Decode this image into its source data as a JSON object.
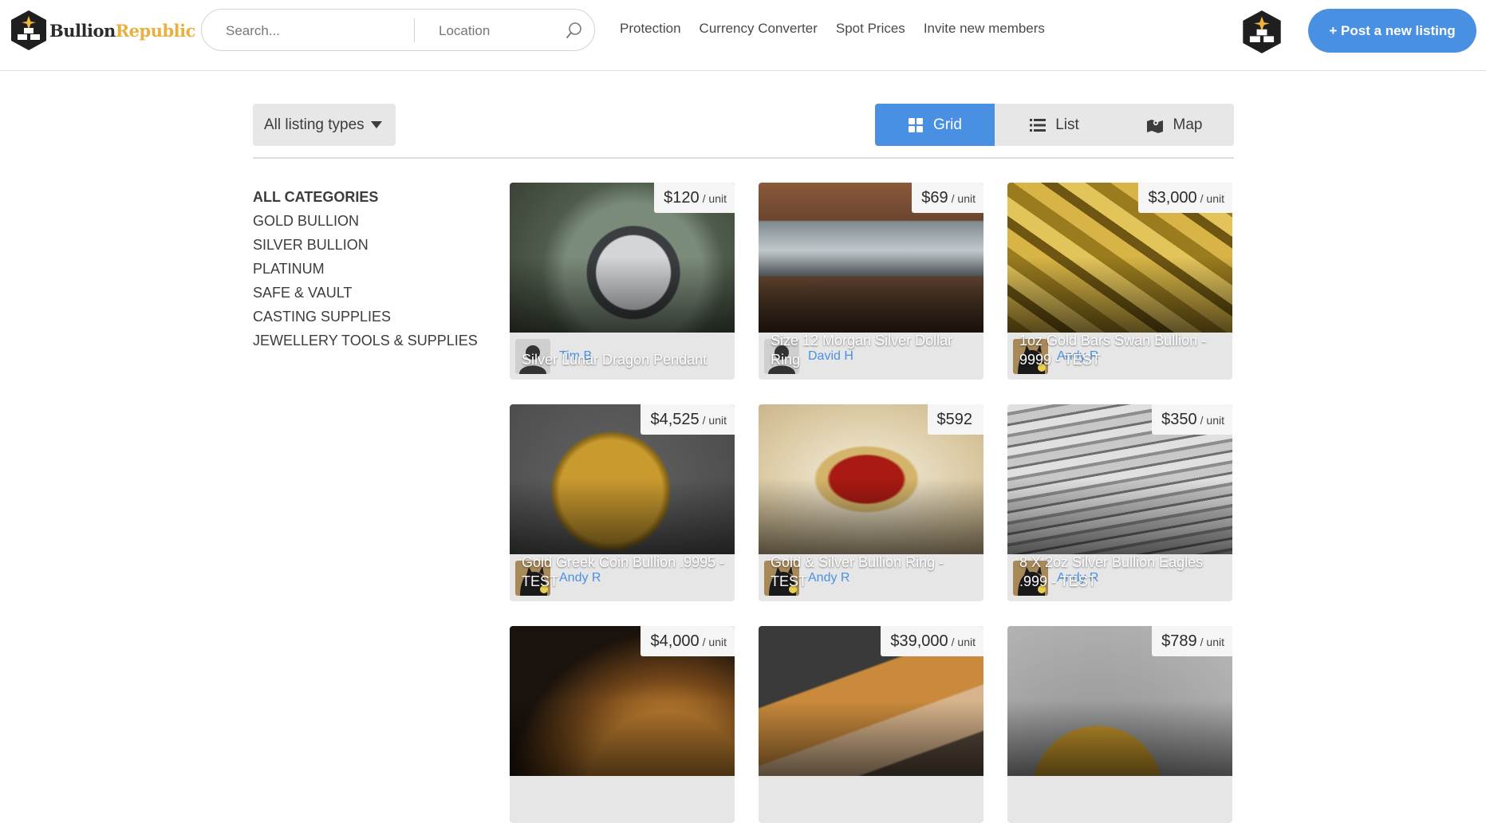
{
  "brand": {
    "name_part1": "Bullion",
    "name_part2": "Republic",
    "gold_color": "#e8b040"
  },
  "search": {
    "placeholder": "Search...",
    "location_placeholder": "Location"
  },
  "nav": {
    "items": [
      "Protection",
      "Currency Converter",
      "Spot Prices",
      "Invite new members"
    ]
  },
  "header": {
    "post_button": "+ Post a new listing",
    "accent_color": "#4a90e2"
  },
  "filter": {
    "listing_type": "All listing types"
  },
  "views": {
    "items": [
      "Grid",
      "List",
      "Map"
    ],
    "active": "Grid"
  },
  "sidebar": {
    "categories": [
      "All categories",
      "Gold Bullion",
      "Silver Bullion",
      "Platinum",
      "Safe & Vault",
      "Casting Supplies",
      "Jewellery Tools & Supplies"
    ],
    "selected": "All categories"
  },
  "listings": [
    {
      "title": "Silver Lunar Dragon Pendant",
      "price": "$120",
      "unit": "/ unit",
      "author": "Tim B",
      "author_avatar": "default-user-icon",
      "image": "pendant-photo"
    },
    {
      "title": "Size 12 Morgan Silver Dollar Ring",
      "price": "$69",
      "unit": "/ unit",
      "author": "David H",
      "author_avatar": "default-user-icon",
      "image": "ring-photo"
    },
    {
      "title": "1oz Gold Bars Swan Bullion - 9999 - TEST",
      "price": "$3,000",
      "unit": "/ unit",
      "author": "Andy R",
      "author_avatar": "cat-photo",
      "image": "gold-bars-photo"
    },
    {
      "title": "Gold Greek Coin Bullion .9995 - TEST",
      "price": "$4,525",
      "unit": "/ unit",
      "author": "Andy R",
      "author_avatar": "cat-photo",
      "image": "greek-coin-photo"
    },
    {
      "title": "Gold & Silver Bullion Ring - TEST",
      "price": "$592",
      "unit": "",
      "author": "Andy R",
      "author_avatar": "cat-photo",
      "image": "red-stone-ring-photo"
    },
    {
      "title": "8 X 2oz Silver Bullion Eagles .999 - TEST",
      "price": "$350",
      "unit": "/ unit",
      "author": "Andy R",
      "author_avatar": "cat-photo",
      "image": "silver-eagles-photo"
    },
    {
      "title": "",
      "price": "$4,000",
      "unit": "/ unit",
      "author": "",
      "author_avatar": "",
      "image": "gold-coin-photo"
    },
    {
      "title": "",
      "price": "$39,000",
      "unit": "/ unit",
      "author": "",
      "author_avatar": "",
      "image": "gold-bar-hand-photo"
    },
    {
      "title": "",
      "price": "$789",
      "unit": "/ unit",
      "author": "",
      "author_avatar": "",
      "image": "gold-nugget-photo"
    }
  ]
}
